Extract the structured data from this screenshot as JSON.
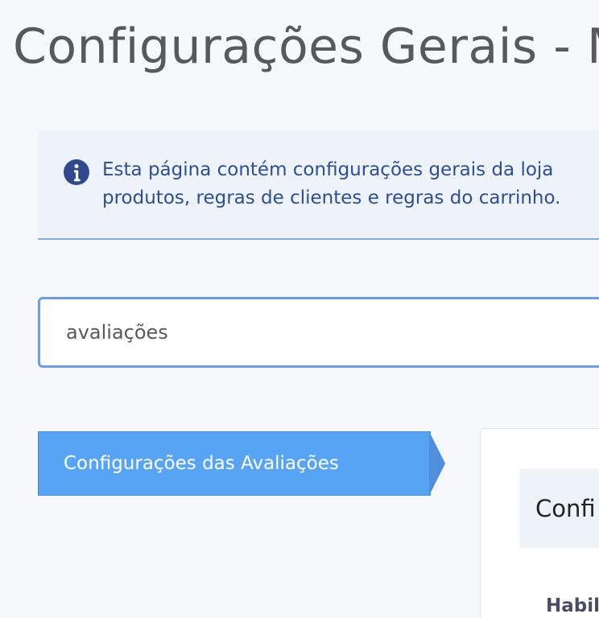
{
  "page": {
    "title": "Configurações Gerais - M"
  },
  "info": {
    "icon": "info-icon",
    "line1": "Esta página contém configurações gerais da loja",
    "line2": "produtos, regras de clientes e regras do carrinho."
  },
  "search": {
    "value": "avaliações"
  },
  "sidebar": {
    "items": [
      {
        "label": "Configurações das Avaliações",
        "active": true
      }
    ]
  },
  "panel": {
    "title": "Confi",
    "field_label": "Habil"
  },
  "colors": {
    "background": "#f7f8f9",
    "title_text": "#58595b",
    "info_background": "#eef2f9",
    "info_text": "#2d4f8e",
    "input_border": "#6c9cf0",
    "active_menu": "#57a4f5",
    "panel_background": "#ffffff"
  }
}
